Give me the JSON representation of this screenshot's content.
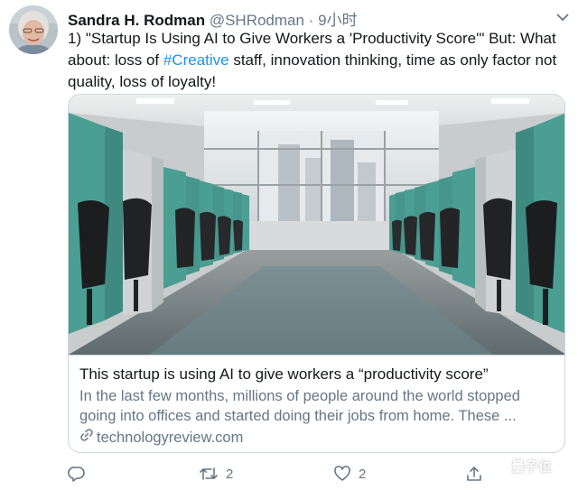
{
  "tweet": {
    "author_name": "Sandra H. Rodman",
    "handle": "@SHRodman",
    "separator": "·",
    "time": "9小时",
    "text_before": "1) \"Startup Is Using AI to Give Workers a 'Productivity Score'\" But: What about: loss of ",
    "hashtag": "#Creative",
    "text_after": " staff,  innovation thinking, time as only factor not quality, loss of loyalty!"
  },
  "card": {
    "title": "This startup is using AI to give workers a “productivity score”",
    "description": "In the last few months, millions of people around the world stopped going into offices and started doing their jobs from home. These ...",
    "domain": "technologyreview.com"
  },
  "actions": {
    "reply_icon": "reply-icon",
    "retweet_count": "2",
    "like_count": "2",
    "share_icon": "share-icon"
  },
  "watermark": {
    "text": "量子位"
  },
  "colors": {
    "link": "#1b95e0",
    "secondary": "#657786",
    "border": "#ccd6dd",
    "cubicle_teal": "#4a9e92"
  }
}
